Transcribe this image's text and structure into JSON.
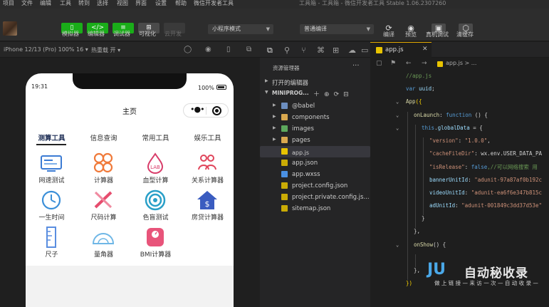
{
  "menubar": {
    "items": [
      "项目",
      "文件",
      "编辑",
      "工具",
      "转到",
      "选择",
      "视图",
      "界面",
      "设置",
      "帮助",
      "微信开发者工具"
    ],
    "window_title": "工具箱 - 工具箱 - 微信开发者工具 Stable 1.06.2307260"
  },
  "toolbar": {
    "buttons": [
      {
        "label": "模拟器",
        "glyph": "▯"
      },
      {
        "label": "编辑器",
        "glyph": "</>"
      },
      {
        "label": "调试器",
        "glyph": "≡"
      },
      {
        "label": "可视化",
        "glyph": "⊞"
      },
      {
        "label": "云开发",
        "glyph": ""
      }
    ],
    "mode_select": "小程序模式",
    "compile_select": "普通编译",
    "right_actions": [
      {
        "label": "编译",
        "glyph": "⟳"
      },
      {
        "label": "预览",
        "glyph": "◉"
      },
      {
        "label": "真机调试",
        "glyph": "▣"
      },
      {
        "label": "清缓存",
        "glyph": "⬡"
      }
    ]
  },
  "simulator_bar": {
    "device": "iPhone 12/13 (Pro) 100% 16 ▾",
    "hot_reload": "热重载 开 ▾"
  },
  "phone": {
    "time": "19:31",
    "battery": "100%",
    "nav_title": "主页",
    "tabs": [
      "测算工具",
      "信息查询",
      "常用工具",
      "娱乐工具"
    ],
    "active_tab": 0,
    "tools": [
      {
        "label": "网速测试",
        "icon": "speed-test-icon",
        "color": "#3b7bd4"
      },
      {
        "label": "计算器",
        "icon": "calculator-icon",
        "color": "#f07a3a"
      },
      {
        "label": "血型计算",
        "icon": "blood-type-icon",
        "color": "#d83d6a"
      },
      {
        "label": "关系计算器",
        "icon": "relationship-icon",
        "color": "#e0445a"
      },
      {
        "label": "一生时间",
        "icon": "lifetime-clock-icon",
        "color": "#3b8fd8"
      },
      {
        "label": "尺码计算",
        "icon": "size-ruler-icon",
        "color": "#e64d6e"
      },
      {
        "label": "色盲测试",
        "icon": "color-target-icon",
        "color": "#2aa0c8"
      },
      {
        "label": "房贷计算器",
        "icon": "mortgage-house-icon",
        "color": "#3a5cc0"
      },
      {
        "label": "尺子",
        "icon": "ruler-icon",
        "color": "#5a8ee0"
      },
      {
        "label": "量角器",
        "icon": "protractor-icon",
        "color": "#6fb7e6"
      },
      {
        "label": "BMI计算器",
        "icon": "bmi-scale-icon",
        "color": "#e8547a"
      }
    ]
  },
  "explorer": {
    "header": "资源管理器",
    "open_editors": "打开的编辑器",
    "project": "MINIPROG...",
    "files": [
      {
        "name": "@babel",
        "type": "folder",
        "color": "#6c8ebf"
      },
      {
        "name": "components",
        "type": "folder",
        "color": "#d9a84f"
      },
      {
        "name": "images",
        "type": "folder",
        "color": "#5da85d"
      },
      {
        "name": "pages",
        "type": "folder",
        "color": "#d9a84f"
      },
      {
        "name": "app.js",
        "type": "js",
        "color": "#e8c300"
      },
      {
        "name": "app.json",
        "type": "json",
        "color": "#e8c300"
      },
      {
        "name": "app.wxss",
        "type": "wxss",
        "color": "#4a90e2"
      },
      {
        "name": "project.config.json",
        "type": "json",
        "color": "#e8c300"
      },
      {
        "name": "project.private.config.js...",
        "type": "json",
        "color": "#e8c300"
      },
      {
        "name": "sitemap.json",
        "type": "json",
        "color": "#e8c300"
      }
    ],
    "selected_index": 4
  },
  "editor": {
    "tab": "app.js",
    "breadcrumb": "app.js > ...",
    "lines": [
      {
        "indent": 0,
        "tokens": [
          [
            "c-cm",
            "//app.js"
          ]
        ]
      },
      {
        "indent": 0,
        "tokens": [
          [
            "c-kw",
            "var"
          ],
          [
            "c-pu",
            " "
          ],
          [
            "c-pr",
            "uuid"
          ],
          [
            "c-pu",
            ";"
          ]
        ]
      },
      {
        "indent": 0,
        "tokens": [
          [
            "c-fn",
            "App"
          ],
          [
            "c-br",
            "({"
          ]
        ]
      },
      {
        "indent": 1,
        "tokens": [
          [
            "c-fn",
            "onLaunch"
          ],
          [
            "c-pu",
            ": "
          ],
          [
            "c-kw",
            "function"
          ],
          [
            "c-pu",
            " () {"
          ]
        ]
      },
      {
        "indent": 2,
        "tokens": [
          [
            "c-kw",
            "this"
          ],
          [
            "c-pu",
            "."
          ],
          [
            "c-pr",
            "globalData"
          ],
          [
            "c-pu",
            " = {"
          ]
        ]
      },
      {
        "indent": 3,
        "tokens": [
          [
            "c-st",
            "\"version\""
          ],
          [
            "c-pu",
            ": "
          ],
          [
            "c-st",
            "\"1.0.0\""
          ],
          [
            "c-pu",
            ","
          ]
        ]
      },
      {
        "indent": 3,
        "tokens": [
          [
            "c-st",
            "\"cacheFileDir\""
          ],
          [
            "c-pu",
            ": wx.env.USER_DATA_PA"
          ]
        ]
      },
      {
        "indent": 3,
        "tokens": [
          [
            "c-st",
            "\"isRelease\""
          ],
          [
            "c-pu",
            ": "
          ],
          [
            "c-kw",
            "false"
          ],
          [
            "c-cm",
            ",//可以网络搜索 用"
          ]
        ]
      },
      {
        "indent": 3,
        "tokens": [
          [
            "c-pr",
            "bannerUnitId"
          ],
          [
            "c-pu",
            ": "
          ],
          [
            "c-st",
            "\"adunit-97a87af0b192c"
          ]
        ]
      },
      {
        "indent": 3,
        "tokens": [
          [
            "c-pr",
            "videoUnitId"
          ],
          [
            "c-pu",
            ": "
          ],
          [
            "c-st",
            "\"adunit-ea6f6e347b815c"
          ]
        ]
      },
      {
        "indent": 3,
        "tokens": [
          [
            "c-pr",
            "adUnitId"
          ],
          [
            "c-pu",
            ": "
          ],
          [
            "c-st",
            "\"adunit-001849c3dd37d53e\""
          ]
        ]
      },
      {
        "indent": 2,
        "tokens": [
          [
            "c-pu",
            "}"
          ]
        ]
      },
      {
        "indent": 1,
        "tokens": [
          [
            "c-pu",
            "},"
          ]
        ]
      },
      {
        "indent": 1,
        "tokens": [
          [
            "c-fn",
            "onShow"
          ],
          [
            "c-pu",
            "() {"
          ]
        ]
      },
      {
        "indent": 2,
        "tokens": [
          [
            "c-pu",
            ""
          ]
        ]
      },
      {
        "indent": 1,
        "tokens": [
          [
            "c-pu",
            "},"
          ]
        ]
      },
      {
        "indent": 0,
        "tokens": [
          [
            "c-br",
            "})"
          ]
        ]
      }
    ]
  },
  "watermark": {
    "logo": "JU",
    "title": "自动秘收录",
    "subtitle": "做 上 链 接 — 来 访 一 次 — 自 动 收 录 —"
  }
}
